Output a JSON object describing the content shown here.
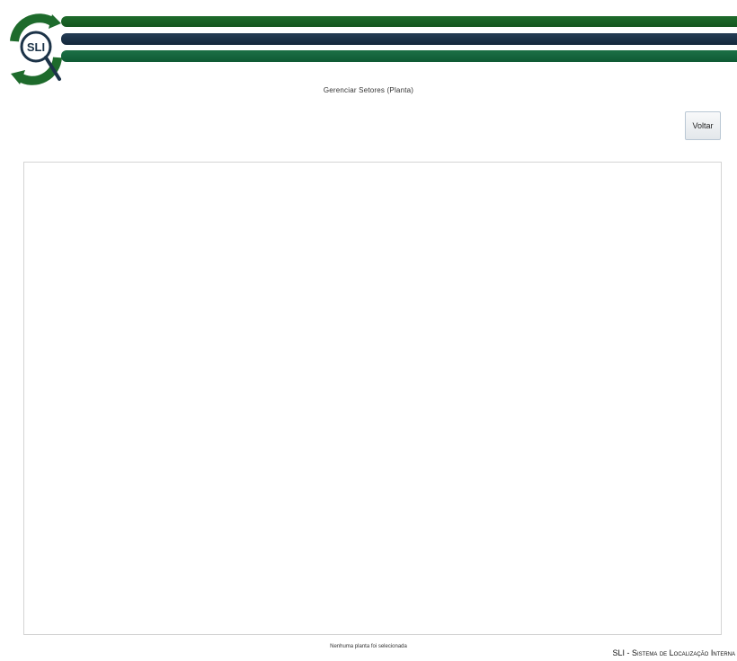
{
  "header": {
    "logo_text": "SLI",
    "title": "Gerenciar Setores (Planta)"
  },
  "actions": {
    "back_label": "Voltar"
  },
  "status": {
    "message": "Nenhuma planta foi selecionada"
  },
  "footer": {
    "brand": "SLI - Sistema de Localização Interna"
  },
  "colors": {
    "green_bar": "#1e6b2c",
    "navy_bar": "#1c3348",
    "green_bar_bottom": "#1a6b43",
    "panel_border": "#d4d4d4",
    "button_border": "#b9c7d4"
  }
}
